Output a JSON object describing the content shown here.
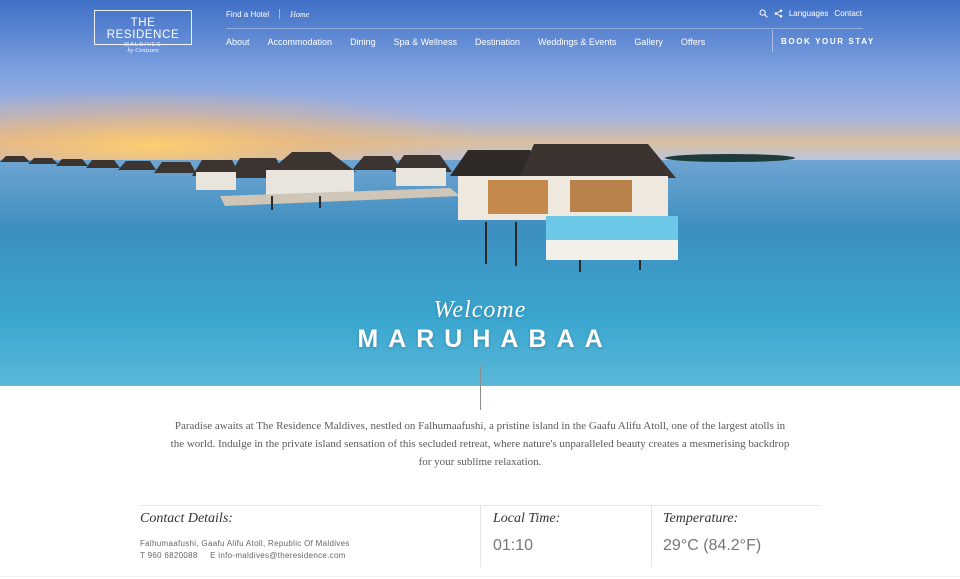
{
  "logo": {
    "title": "THE RESIDENCE",
    "subtitle": "MALDIVES",
    "by": "by Cenizaro"
  },
  "top_links": {
    "find_hotel": "Find a Hotel",
    "home": "Home"
  },
  "top_right": {
    "languages": "Languages",
    "contact": "Contact"
  },
  "nav": {
    "items": [
      "About",
      "Accommodation",
      "Dining",
      "Spa & Wellness",
      "Destination",
      "Weddings & Events",
      "Gallery",
      "Offers"
    ],
    "book": "BOOK YOUR STAY"
  },
  "hero": {
    "welcome": "Welcome",
    "title": "MARUHABAA"
  },
  "intro": "Paradise awaits at The Residence Maldives, nestled on Falhumaafushi, a pristine island in the Gaafu Alifu Atoll, one of the largest atolls in the world. Indulge in the private island sensation of this secluded retreat, where nature's unparalleled beauty creates a mesmerising backdrop for your sublime relaxation.",
  "info": {
    "contact_heading": "Contact Details:",
    "address": "Falhumaafushi, Gaafu Alifu Atoll, Republic Of Maldives",
    "phone": "T 960 6820088",
    "email": "E info-maldives@theresidence.com",
    "time_heading": "Local Time:",
    "time_value": "01:10",
    "temp_heading": "Temperature:",
    "temp_value": "29°C (84.2°F)"
  },
  "icons": [
    "search-icon",
    "share-icon"
  ],
  "colors": {
    "sky_top": "#4f7fcf",
    "sunset": "#f0b85a",
    "water": "#4aa3c9"
  }
}
